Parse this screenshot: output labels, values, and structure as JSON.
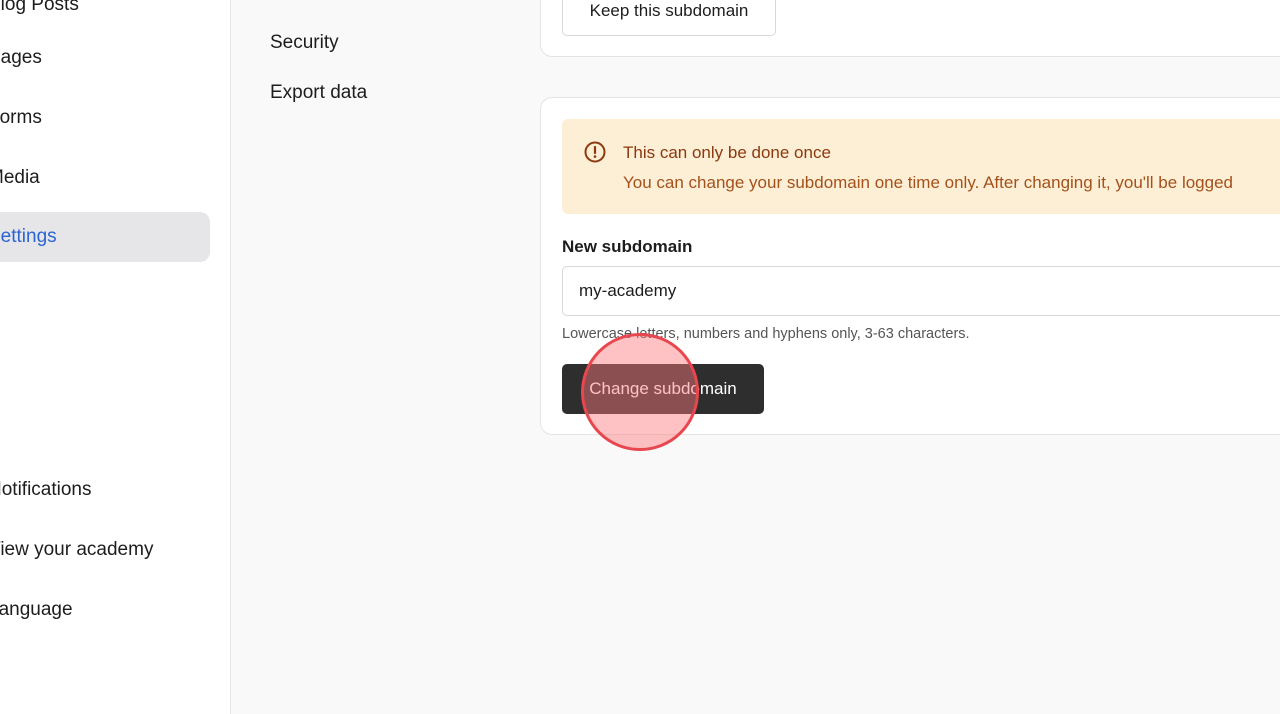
{
  "sidebar": {
    "items": [
      {
        "label": "Blog Posts",
        "active": false
      },
      {
        "label": "Pages",
        "active": false
      },
      {
        "label": "Forms",
        "active": false
      },
      {
        "label": "Media",
        "active": false
      },
      {
        "label": "Settings",
        "active": true
      }
    ],
    "bottom_items": [
      {
        "label": "Notifications"
      },
      {
        "label": "View your academy"
      },
      {
        "label": "Language"
      }
    ]
  },
  "settings_nav": {
    "items": [
      {
        "label": "Security"
      },
      {
        "label": "Export data"
      }
    ]
  },
  "keep_card": {
    "button_label": "Keep this subdomain"
  },
  "change_card": {
    "alert": {
      "icon": "alert-circle-icon",
      "title": "This can only be done once",
      "body": "You can change your subdomain one time only. After changing it, you'll be logged"
    },
    "field_label": "New subdomain",
    "input_value": "my-academy",
    "help_text": "Lowercase letters, numbers and hyphens only, 3-63 characters.",
    "submit_label": "Change subdomain"
  },
  "colors": {
    "accent": "#2c64d3",
    "alert_bg": "#fdeed6",
    "alert_text": "#8a3a0e",
    "primary_button": "#2e2e2f",
    "click_indicator": "#e8474e"
  }
}
